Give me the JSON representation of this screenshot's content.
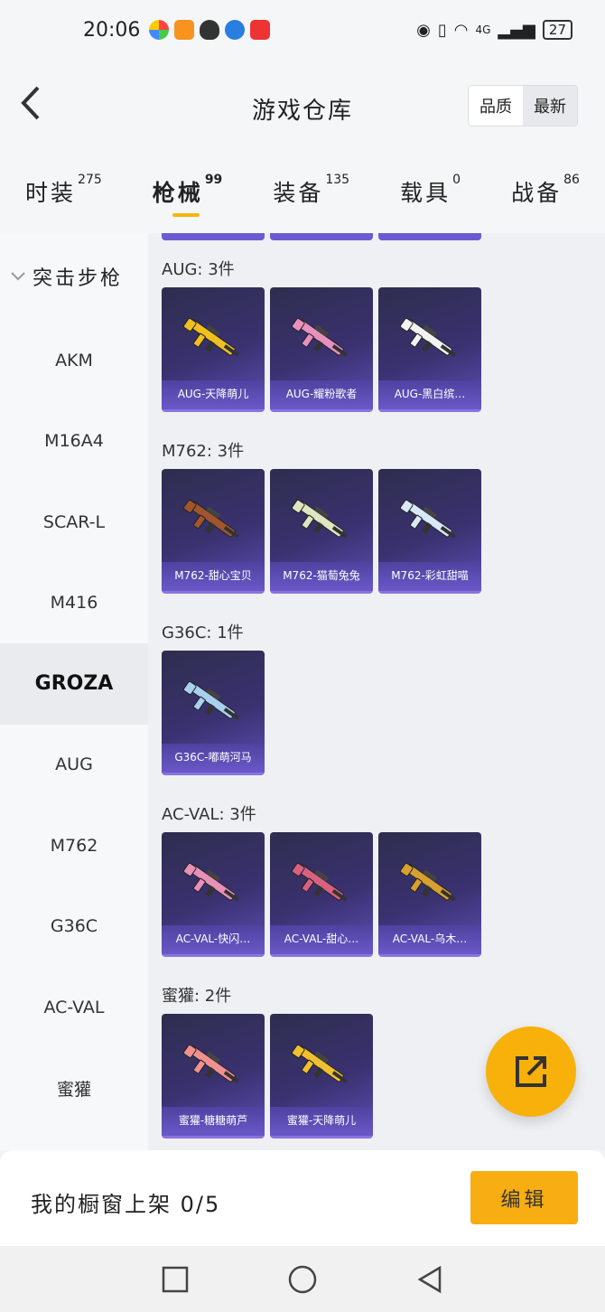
{
  "status": {
    "time": "20:06",
    "network": "4G",
    "battery": "27"
  },
  "header": {
    "title": "游戏仓库",
    "sort": [
      "品质",
      "最新"
    ]
  },
  "tabs": [
    {
      "label": "时装",
      "count": "275"
    },
    {
      "label": "枪械",
      "count": "99"
    },
    {
      "label": "装备",
      "count": "135"
    },
    {
      "label": "载具",
      "count": "0"
    },
    {
      "label": "战备",
      "count": "86"
    }
  ],
  "sidebar": {
    "group": "突击步枪",
    "items": [
      "AKM",
      "M16A4",
      "SCAR-L",
      "M416",
      "GROZA",
      "AUG",
      "M762",
      "G36C",
      "AC-VAL",
      "蜜獾"
    ]
  },
  "groups": [
    {
      "label": "AUG: 3件",
      "items": [
        "AUG-天降萌儿",
        "AUG-耀粉歌者",
        "AUG-黑白缤…"
      ]
    },
    {
      "label": "M762: 3件",
      "items": [
        "M762-甜心宝贝",
        "M762-猫萄兔兔",
        "M762-彩虹甜喵"
      ]
    },
    {
      "label": "G36C: 1件",
      "items": [
        "G36C-嘟萌河马"
      ]
    },
    {
      "label": "AC-VAL: 3件",
      "items": [
        "AC-VAL-快闪…",
        "AC-VAL-甜心…",
        "AC-VAL-乌木…"
      ]
    },
    {
      "label": "蜜獾: 2件",
      "items": [
        "蜜獾-糖糖萌芦",
        "蜜獾-天降萌儿"
      ]
    }
  ],
  "gun_colors": [
    "#f0c020",
    "#e890c0",
    "#f2f2f2",
    "#a0552e",
    "#dfe6c0",
    "#d8e8f8",
    "#a8d0f0",
    "#e890b8",
    "#d86080",
    "#d8a030",
    "#f09090",
    "#f0c030"
  ],
  "footer": {
    "showcase": "我的橱窗上架 0/5",
    "edit": "编辑"
  },
  "icons": {
    "back": "chevron-left-icon",
    "fab": "share-external-icon"
  }
}
